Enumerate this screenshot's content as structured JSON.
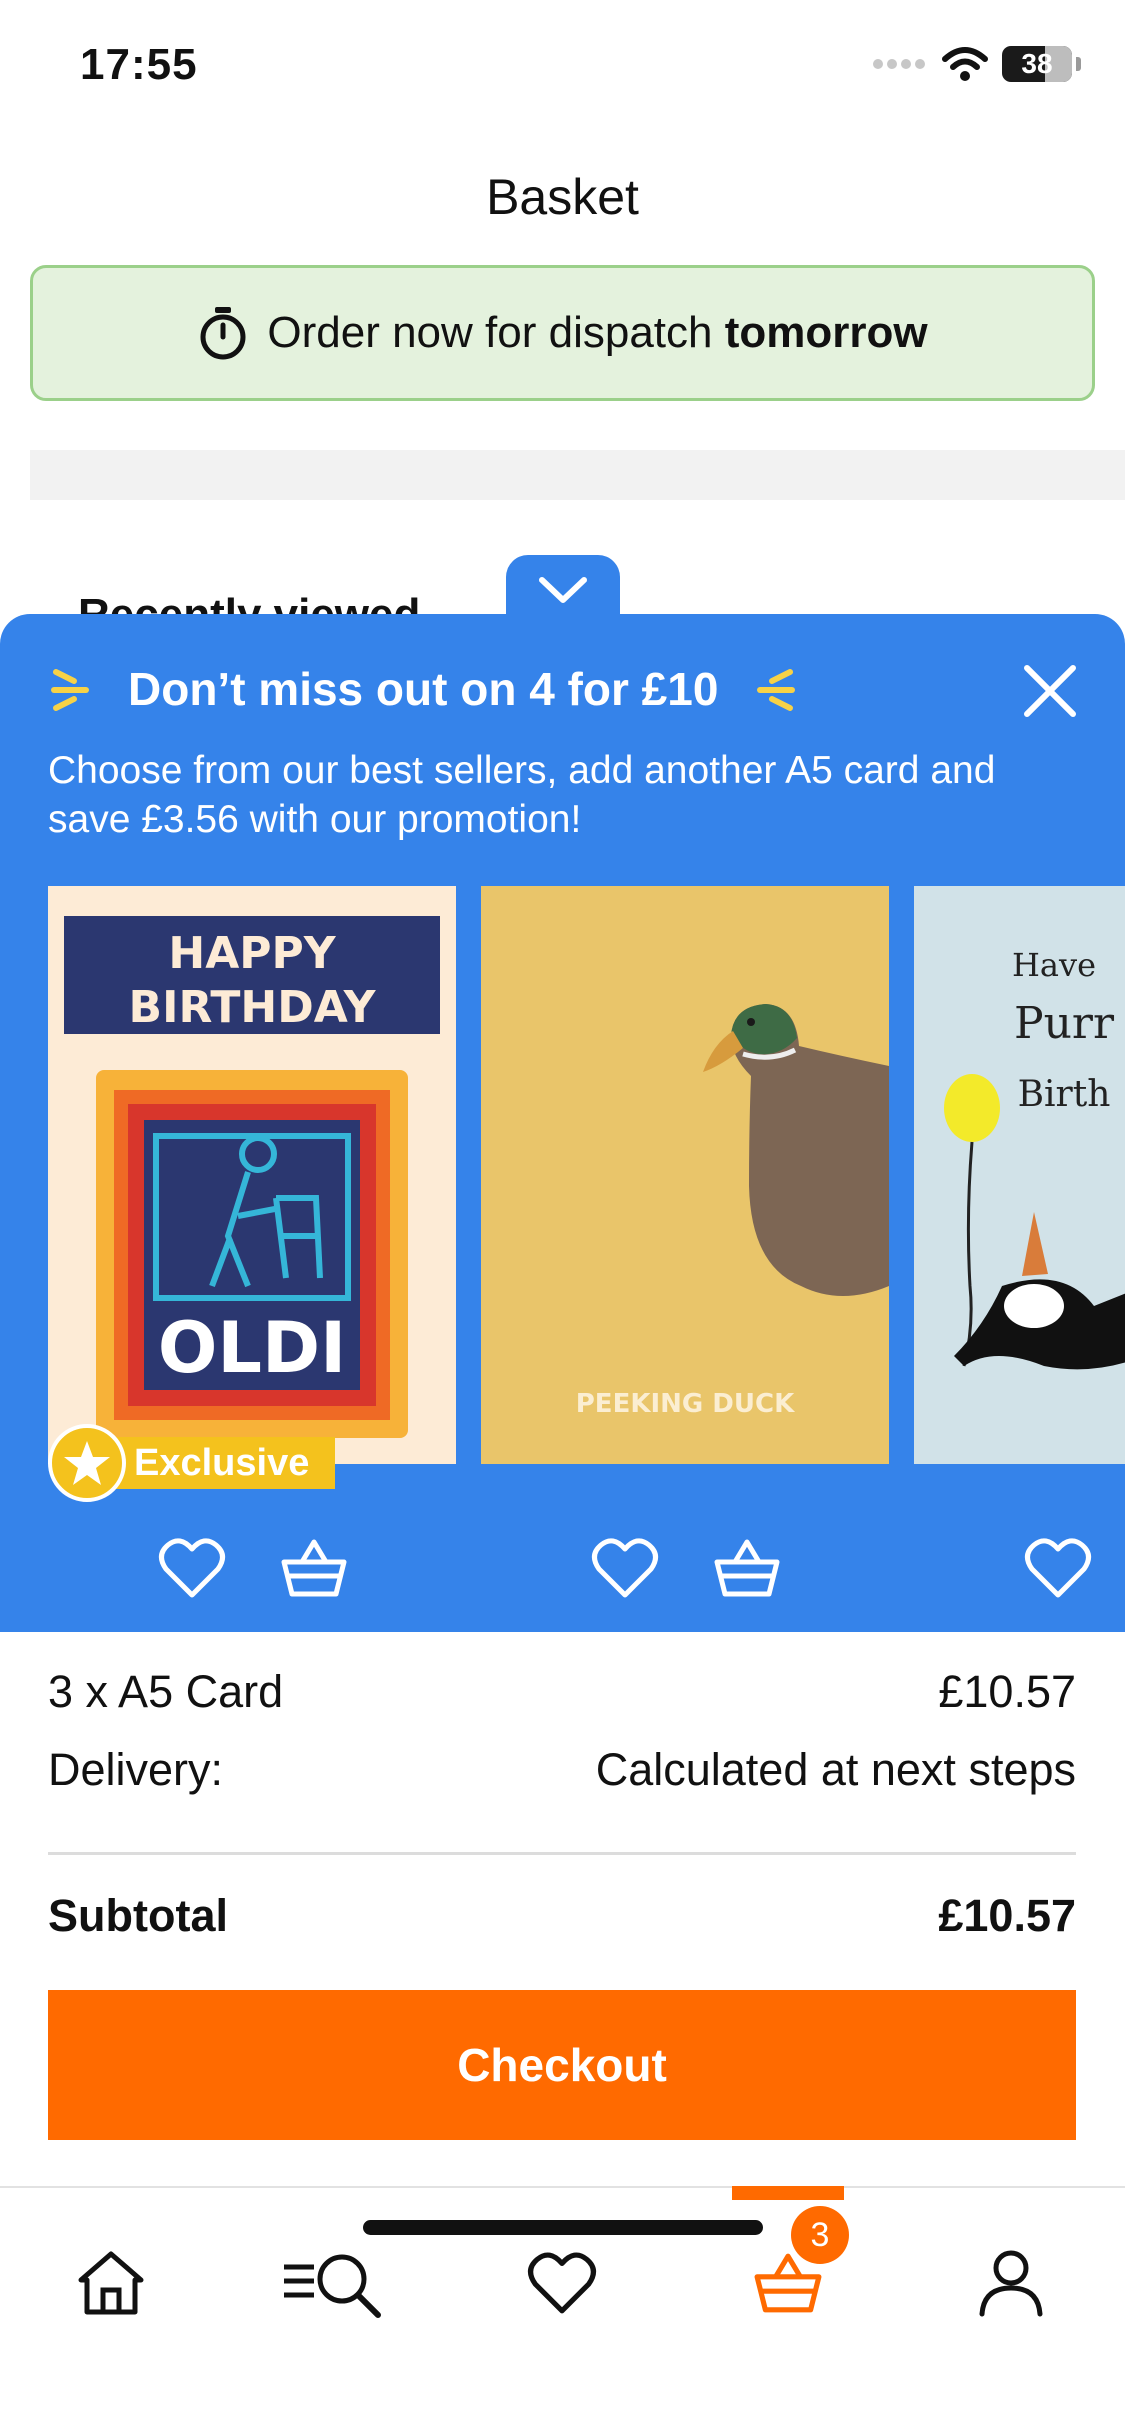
{
  "status_bar": {
    "time": "17:55",
    "battery": "38"
  },
  "header": {
    "title": "Basket"
  },
  "dispatch_banner": {
    "text": "Order now for dispatch",
    "highlight": "tomorrow"
  },
  "recently_viewed": {
    "label": "Recently viewed"
  },
  "promo": {
    "title": "Don’t miss out on 4 for £10",
    "subtitle": "Choose from our best sellers, add another A5 card and save £3.56 with our promotion!",
    "cards": [
      {
        "text_top": "HAPPY BIRTHDAY",
        "text_main": "OLDI",
        "badge": "Exclusive"
      },
      {
        "text_main": "PEEKING DUCK"
      },
      {
        "text_main": "Have a Purr Birth"
      }
    ]
  },
  "summary": {
    "items_label": "3 x A5 Card",
    "items_value": "£10.57",
    "delivery_label": "Delivery:",
    "delivery_value": "Calculated at next steps",
    "subtotal_label": "Subtotal",
    "subtotal_value": "£10.57"
  },
  "checkout": {
    "label": "Checkout"
  },
  "tab_bar": {
    "basket_count": "3"
  },
  "colors": {
    "promo_blue": "#3583ea",
    "accent_orange": "#ff6a00",
    "banner_green": "#e4f2dd"
  }
}
